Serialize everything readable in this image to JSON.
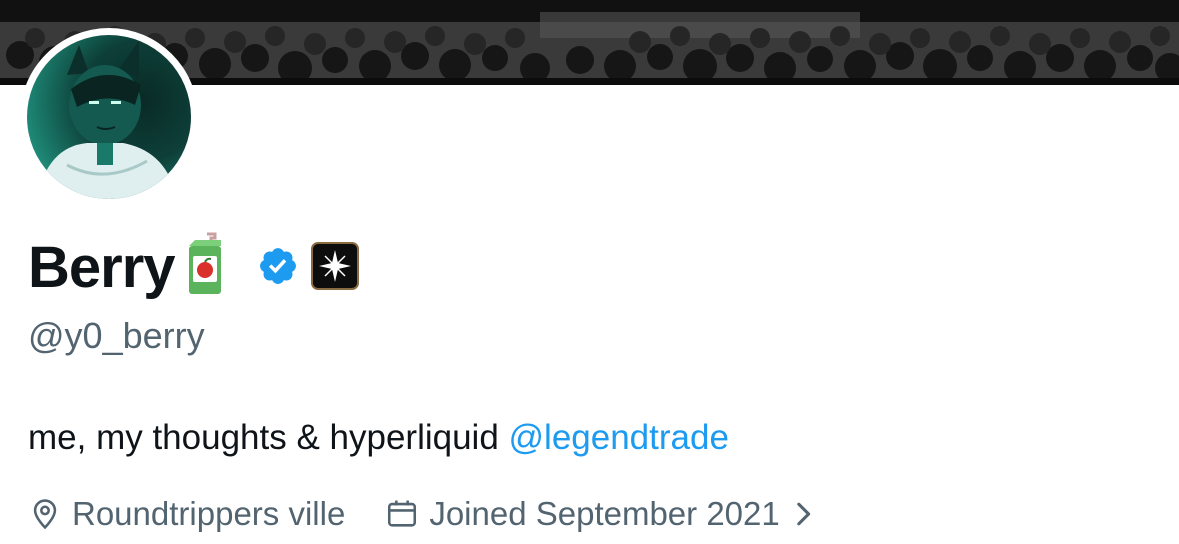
{
  "profile": {
    "display_name": "Berry",
    "handle": "@y0_berry",
    "bio_text": "me, my thoughts & hyperliquid ",
    "bio_mention": "@legendtrade",
    "location": "Roundtrippers ville",
    "joined": "Joined September 2021"
  },
  "icons": {
    "name_emoji": "juice-box-icon",
    "verified": "verified-badge-icon",
    "affiliate": "affiliate-badge-icon",
    "location": "location-pin-icon",
    "calendar": "calendar-icon",
    "chevron": "chevron-right-icon"
  },
  "colors": {
    "link": "#1d9bf0",
    "secondary_text": "#536471",
    "verified": "#1d9bf0"
  }
}
